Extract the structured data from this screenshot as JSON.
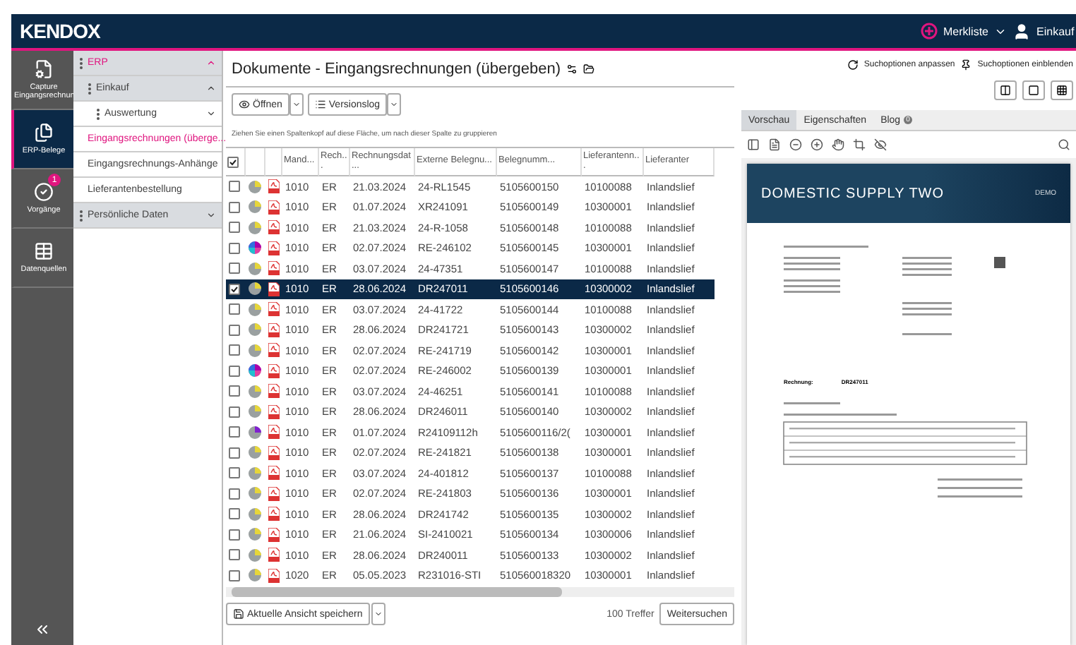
{
  "topbar": {
    "logo": "KENDOX",
    "merkliste": "Merkliste",
    "user": "Einkauf"
  },
  "rail": [
    {
      "label": "Capture Eingangsrechnun",
      "selected": false
    },
    {
      "label": "ERP-Belege",
      "selected": true
    },
    {
      "label": "Vorgänge",
      "selected": false,
      "badge": "1"
    },
    {
      "label": "Datenquellen",
      "selected": false
    }
  ],
  "tree": [
    {
      "kind": "group",
      "label": "ERP",
      "expanded": true,
      "children": [
        {
          "kind": "group",
          "label": "Einkauf",
          "expanded": true,
          "children": [
            {
              "kind": "group",
              "label": "Auswertung",
              "expanded": false
            },
            {
              "kind": "leaf",
              "label": "Eingangsrechnungen (überge...",
              "selected": true
            },
            {
              "kind": "leaf",
              "label": "Eingangsrechnungs-Anhänge",
              "selected": false
            },
            {
              "kind": "leaf",
              "label": "Lieferantenbestellung",
              "selected": false
            }
          ]
        }
      ]
    },
    {
      "kind": "group",
      "label": "Persönliche Daten",
      "expanded": false
    }
  ],
  "main": {
    "title": "Dokumente - Eingangsrechnungen (übergeben)",
    "search_adjust": "Suchoptionen anpassen",
    "search_show": "Suchoptionen einblenden",
    "buttons": [
      "Öffnen",
      "Versionslog"
    ],
    "group_hint": "Ziehen Sie einen Spaltenkopf auf diese Fläche, um nach dieser Spalte zu gruppieren",
    "select_all_checked": true,
    "columns": [
      "Mand...",
      "Rech...",
      "Rechnungsdat...",
      "Externe Belegnu...",
      "Belegnumm...",
      "Lieferantenn...",
      "Lieferanter"
    ],
    "rows": [
      {
        "kind": "standard",
        "selected": false,
        "cells": [
          "1010",
          "ER",
          "21.03.2024",
          "24-RL1545",
          "5105600150",
          "10100088",
          "Inlandslief"
        ]
      },
      {
        "kind": "standard",
        "selected": false,
        "cells": [
          "1010",
          "ER",
          "01.07.2024",
          "XR241091",
          "5105600149",
          "10300001",
          "Inlandslief"
        ]
      },
      {
        "kind": "standard",
        "selected": false,
        "cells": [
          "1010",
          "ER",
          "21.03.2024",
          "24-R-1058",
          "5105600148",
          "10100088",
          "Inlandslief"
        ]
      },
      {
        "kind": "colorful",
        "selected": false,
        "cells": [
          "1010",
          "ER",
          "02.07.2024",
          "RE-246102",
          "5105600145",
          "10300001",
          "Inlandslief"
        ]
      },
      {
        "kind": "standard",
        "selected": false,
        "cells": [
          "1010",
          "ER",
          "03.07.2024",
          "24-47351",
          "5105600147",
          "10100088",
          "Inlandslief"
        ]
      },
      {
        "kind": "standard",
        "selected": true,
        "cells": [
          "1010",
          "ER",
          "28.06.2024",
          "DR247011",
          "5105600146",
          "10300002",
          "Inlandslief"
        ]
      },
      {
        "kind": "standard",
        "selected": false,
        "cells": [
          "1010",
          "ER",
          "03.07.2024",
          "24-41722",
          "5105600144",
          "10100088",
          "Inlandslief"
        ]
      },
      {
        "kind": "standard",
        "selected": false,
        "cells": [
          "1010",
          "ER",
          "28.06.2024",
          "DR241721",
          "5105600143",
          "10300002",
          "Inlandslief"
        ]
      },
      {
        "kind": "standard",
        "selected": false,
        "cells": [
          "1010",
          "ER",
          "02.07.2024",
          "RE-241719",
          "5105600142",
          "10300001",
          "Inlandslief"
        ]
      },
      {
        "kind": "colorful",
        "selected": false,
        "cells": [
          "1010",
          "ER",
          "02.07.2024",
          "RE-246002",
          "5105600139",
          "10300001",
          "Inlandslief"
        ]
      },
      {
        "kind": "standard",
        "selected": false,
        "cells": [
          "1010",
          "ER",
          "03.07.2024",
          "24-46251",
          "5105600141",
          "10100088",
          "Inlandslief"
        ]
      },
      {
        "kind": "standard",
        "selected": false,
        "cells": [
          "1010",
          "ER",
          "28.06.2024",
          "DR246011",
          "5105600140",
          "10300002",
          "Inlandslief"
        ]
      },
      {
        "kind": "violet",
        "selected": false,
        "cells": [
          "1010",
          "ER",
          "01.07.2024",
          "R24109112h",
          "5105600116/2(",
          "10300001",
          "Inlandslief"
        ]
      },
      {
        "kind": "standard",
        "selected": false,
        "cells": [
          "1010",
          "ER",
          "02.07.2024",
          "RE-241821",
          "5105600138",
          "10300001",
          "Inlandslief"
        ]
      },
      {
        "kind": "standard",
        "selected": false,
        "cells": [
          "1010",
          "ER",
          "03.07.2024",
          "24-401812",
          "5105600137",
          "10100088",
          "Inlandslief"
        ]
      },
      {
        "kind": "standard",
        "selected": false,
        "cells": [
          "1010",
          "ER",
          "02.07.2024",
          "RE-241803",
          "5105600136",
          "10300001",
          "Inlandslief"
        ]
      },
      {
        "kind": "standard",
        "selected": false,
        "cells": [
          "1010",
          "ER",
          "28.06.2024",
          "DR241742",
          "5105600135",
          "10300002",
          "Inlandslief"
        ]
      },
      {
        "kind": "standard",
        "selected": false,
        "cells": [
          "1010",
          "ER",
          "21.06.2024",
          "SI-2410021",
          "5105600134",
          "10300006",
          "Inlandslief"
        ]
      },
      {
        "kind": "standard",
        "selected": false,
        "cells": [
          "1010",
          "ER",
          "28.06.2024",
          "DR240011",
          "5105600133",
          "10300002",
          "Inlandslief"
        ]
      },
      {
        "kind": "standard",
        "selected": false,
        "cells": [
          "1020",
          "ER",
          "05.05.2023",
          "R231016-STI",
          "510560018320",
          "10300001",
          "Inlandslief"
        ]
      }
    ],
    "save_view": "Aktuelle Ansicht speichern",
    "hits": "100 Treffer",
    "more": "Weitersuchen"
  },
  "preview": {
    "tabs": [
      {
        "label": "Vorschau",
        "selected": true
      },
      {
        "label": "Eigenschaften",
        "selected": false
      },
      {
        "label": "Blog",
        "selected": false,
        "badge": "0"
      }
    ],
    "doc_title": "DOMESTIC SUPPLY TWO",
    "doc_stamp": "DEMO",
    "doc_label": "Rechnung:",
    "doc_number": "DR247011"
  }
}
